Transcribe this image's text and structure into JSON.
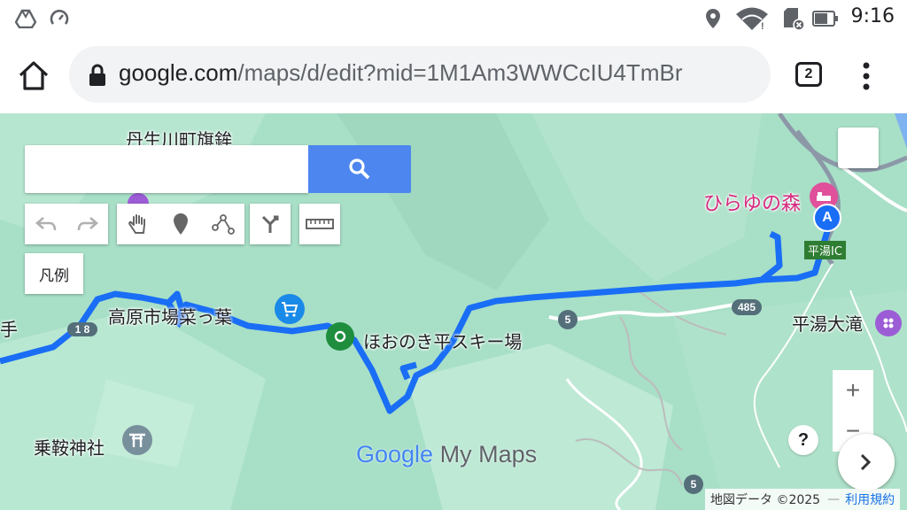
{
  "status_bar": {
    "time": "9:16",
    "icons": [
      "drive-icon",
      "speed-icon",
      "location-icon",
      "wifi-icon",
      "sd-card-icon",
      "battery-icon"
    ]
  },
  "browser": {
    "url_main": "google.com",
    "url_path": "/maps/d/edit?mid=1M1Am3WWCcIU4TmBr",
    "tab_count": "2"
  },
  "map": {
    "search": {
      "placeholder": ""
    },
    "toolbar": [
      "undo-icon",
      "redo-icon",
      "hand-icon",
      "marker-icon",
      "line-icon",
      "directions-icon",
      "ruler-icon"
    ],
    "legend_label": "凡例",
    "labels": {
      "niu": "丹生川町旗鉾",
      "takahara": "高原市場菜っ葉",
      "hoonoki": "ほおのき平スキー場",
      "hirayu_forest": "ひらゆの森",
      "hirayu_ic": "平湯IC",
      "hirayu_falls": "平湯大滝",
      "norikura": "乗鞍神社",
      "te": "手"
    },
    "route_shields": {
      "r158": "1 8",
      "r5a": "5",
      "r485": "485",
      "r5b": "5"
    },
    "marker_a": "A",
    "zoom_in": "+",
    "zoom_out": "−",
    "help": "?",
    "logo_google": "Google",
    "logo_mymaps": "My Maps",
    "attribution": "地図データ ©2025",
    "terms": "利用規約",
    "colors": {
      "route": "#1a6ef5",
      "terrain": "#a8dfc7",
      "search_btn": "#4d86ef"
    }
  }
}
